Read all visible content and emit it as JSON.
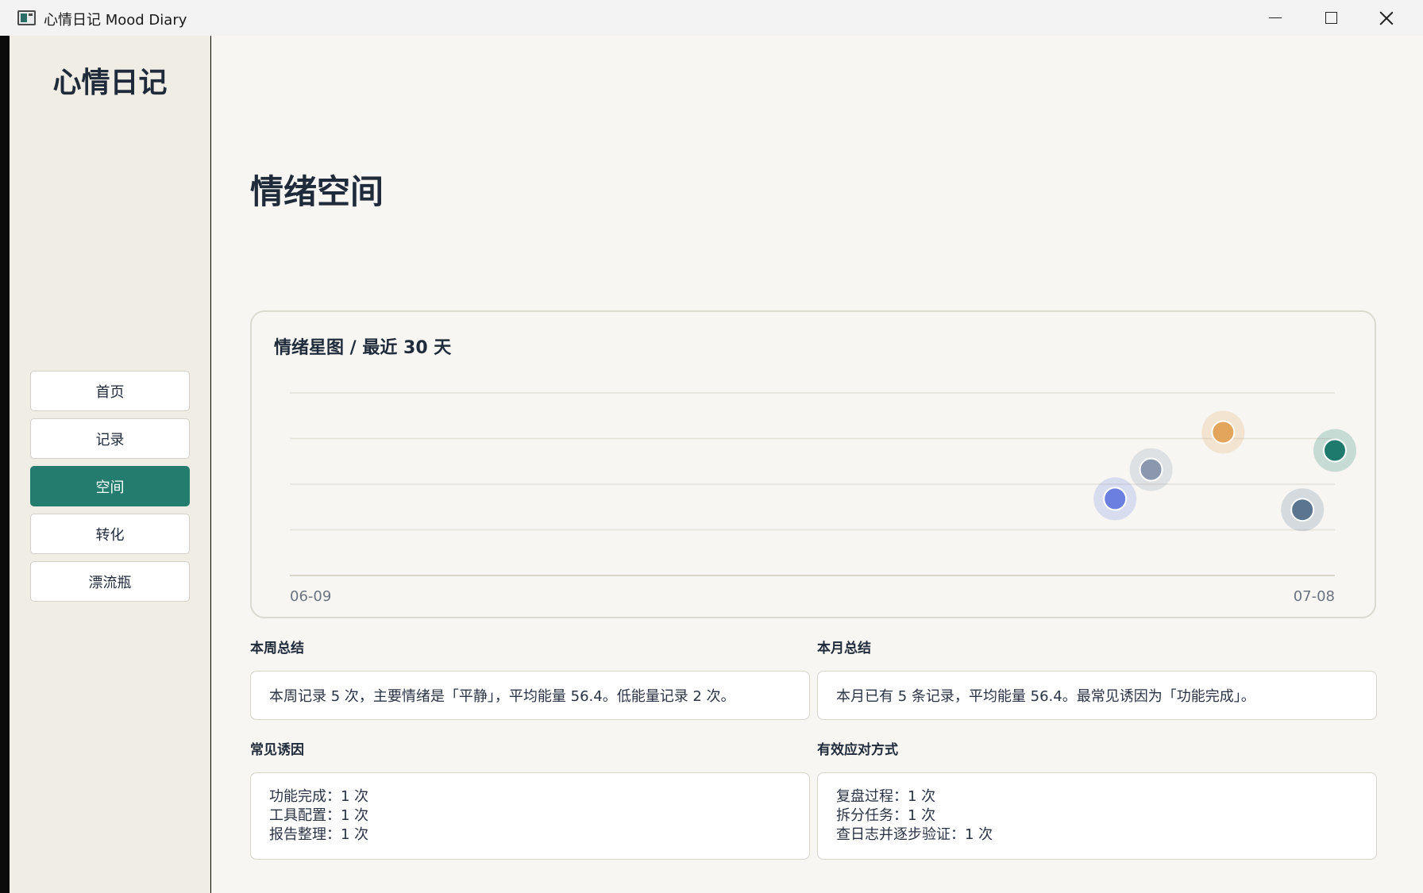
{
  "window": {
    "title": "心情日记 Mood Diary"
  },
  "sidebar": {
    "brand": "心情日记",
    "items": [
      {
        "label": "首页",
        "active": false
      },
      {
        "label": "记录",
        "active": false
      },
      {
        "label": "空间",
        "active": true
      },
      {
        "label": "转化",
        "active": false
      },
      {
        "label": "漂流瓶",
        "active": false
      }
    ]
  },
  "main": {
    "page_title": "情绪空间",
    "chart_card": {
      "title": "情绪星图 / 最近 30 天"
    },
    "week_summary": {
      "label": "本周总结",
      "text": "本周记录 5 次，主要情绪是「平静」，平均能量 56.4。低能量记录 2 次。"
    },
    "month_summary": {
      "label": "本月总结",
      "text": "本月已有 5 条记录，平均能量 56.4。最常见诱因为「功能完成」。"
    },
    "triggers": {
      "label": "常见诱因",
      "items": [
        "功能完成：1 次",
        "工具配置：1 次",
        "报告整理：1 次"
      ]
    },
    "coping": {
      "label": "有效应对方式",
      "items": [
        "复盘过程：1 次",
        "拆分任务：1 次",
        "查日志并逐步验证：1 次"
      ]
    }
  },
  "chart_data": {
    "type": "scatter",
    "title": "情绪星图 / 最近 30 天",
    "x_tick_labels": [
      "06-09",
      "07-08"
    ],
    "x_range_days": [
      0,
      29
    ],
    "y_range": [
      0,
      4
    ],
    "grid": true,
    "points": [
      {
        "day": 22.9,
        "y": 1.68,
        "color": "#6b7fe0"
      },
      {
        "day": 23.9,
        "y": 2.32,
        "color": "#8a97ad"
      },
      {
        "day": 25.9,
        "y": 3.14,
        "color": "#e3a45c"
      },
      {
        "day": 28.1,
        "y": 1.44,
        "color": "#5b7591"
      },
      {
        "day": 29.0,
        "y": 2.74,
        "color": "#1e7a6d"
      }
    ],
    "colors": {
      "accent": "#247c6e",
      "grid": "#e4e1d9"
    }
  }
}
